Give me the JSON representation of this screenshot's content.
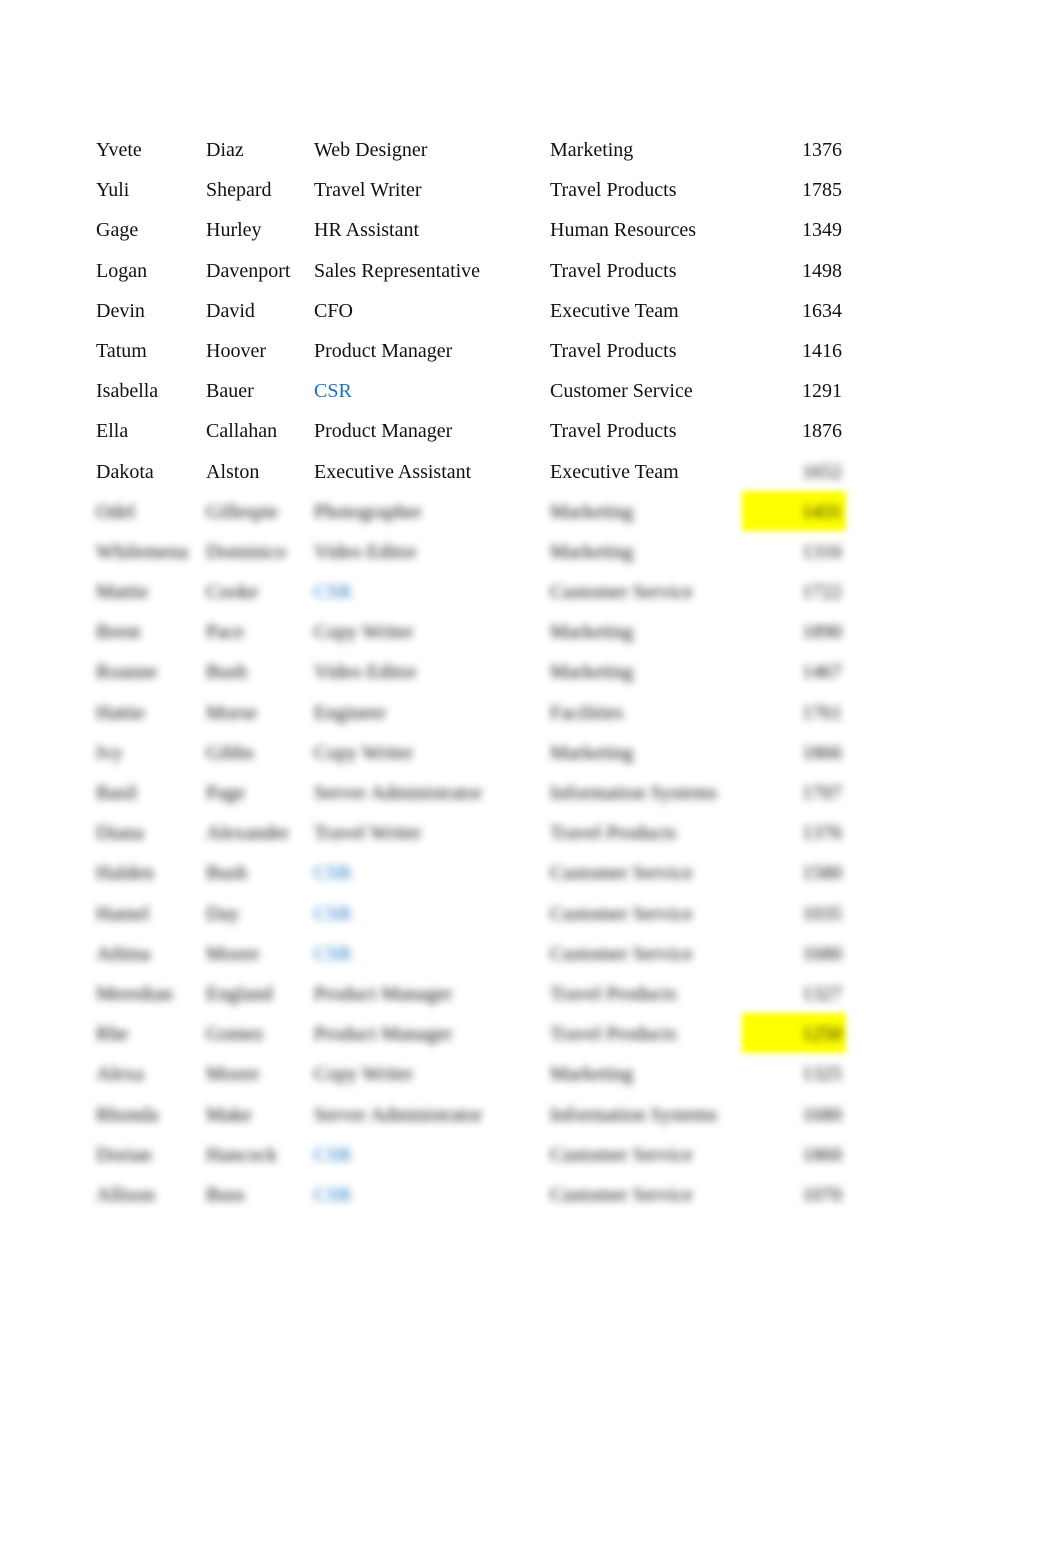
{
  "rows": [
    {
      "first": "Yvete",
      "last": "Diaz",
      "title": "Web Designer",
      "dept": "Marketing",
      "num": "1376"
    },
    {
      "first": "Yuli",
      "last": "Shepard",
      "title": "Travel Writer",
      "dept": "Travel Products",
      "num": "1785"
    },
    {
      "first": "Gage",
      "last": "Hurley",
      "title": "HR Assistant",
      "dept": "Human Resources",
      "num": "1349"
    },
    {
      "first": "Logan",
      "last": "Davenport",
      "title": "Sales Representative",
      "dept": "Travel Products",
      "num": "1498"
    },
    {
      "first": "Devin",
      "last": "David",
      "title": "CFO",
      "dept": "Executive Team",
      "num": "1634"
    },
    {
      "first": "Tatum",
      "last": "Hoover",
      "title": "Product Manager",
      "dept": "Travel Products",
      "num": "1416"
    },
    {
      "first": "Isabella",
      "last": "Bauer",
      "title": "CSR",
      "dept": "Customer Service",
      "num": "1291"
    },
    {
      "first": "Ella",
      "last": "Callahan",
      "title": "Product Manager",
      "dept": "Travel Products",
      "num": "1876"
    },
    {
      "first": "Dakota",
      "last": "Alston",
      "title": "Executive Assistant",
      "dept": "Executive Team",
      "num": "1652"
    },
    {
      "first": "Odel",
      "last": "Gillespie",
      "title": "Photographer",
      "dept": "Marketing",
      "num": "1431"
    },
    {
      "first": "Whilemena",
      "last": "Dominico",
      "title": "Video Editor",
      "dept": "Marketing",
      "num": "1316"
    },
    {
      "first": "Mattie",
      "last": "Cooke",
      "title": "CSR",
      "dept": "Customer Service",
      "num": "1722"
    },
    {
      "first": "Brent",
      "last": "Pace",
      "title": "Copy Writer",
      "dept": "Marketing",
      "num": "1890"
    },
    {
      "first": "Roanne",
      "last": "Bush",
      "title": "Video Editor",
      "dept": "Marketing",
      "num": "1467"
    },
    {
      "first": "Hattie",
      "last": "Morse",
      "title": "Engineer",
      "dept": "Facilities",
      "num": "1761"
    },
    {
      "first": "Ivy",
      "last": "Gibbs",
      "title": "Copy Writer",
      "dept": "Marketing",
      "num": "1866"
    },
    {
      "first": "Basil",
      "last": "Page",
      "title": "Server Administrator",
      "dept": "Information Systems",
      "num": "1707"
    },
    {
      "first": "Diana",
      "last": "Alexander",
      "title": "Travel Writer",
      "dept": "Travel Products",
      "num": "1376"
    },
    {
      "first": "Halden",
      "last": "Bush",
      "title": "CSR",
      "dept": "Customer Service",
      "num": "1580"
    },
    {
      "first": "Hamel",
      "last": "Day",
      "title": "CSR",
      "dept": "Customer Service",
      "num": "1035"
    },
    {
      "first": "Athina",
      "last": "Moore",
      "title": "CSR",
      "dept": "Customer Service",
      "num": "1680"
    },
    {
      "first": "Meredian",
      "last": "England",
      "title": "Product Manager",
      "dept": "Travel Products",
      "num": "1327"
    },
    {
      "first": "Rhe",
      "last": "Gomez",
      "title": "Product Manager",
      "dept": "Travel Products",
      "num": "1250"
    },
    {
      "first": "Alexa",
      "last": "Moore",
      "title": "Copy Writer",
      "dept": "Marketing",
      "num": "1325"
    },
    {
      "first": "Rhonda",
      "last": "Make",
      "title": "Server Administrator",
      "dept": "Information Systems",
      "num": "1680"
    },
    {
      "first": "Dorian",
      "last": "Hancock",
      "title": "CSR",
      "dept": "Customer Service",
      "num": "1860"
    },
    {
      "first": "Allison",
      "last": "Buss",
      "title": "CSR",
      "dept": "Customer Service",
      "num": "1070"
    }
  ],
  "colors": {
    "text": "#111111",
    "csr_link": "#1a73c7",
    "highlight": "#ffff00"
  }
}
